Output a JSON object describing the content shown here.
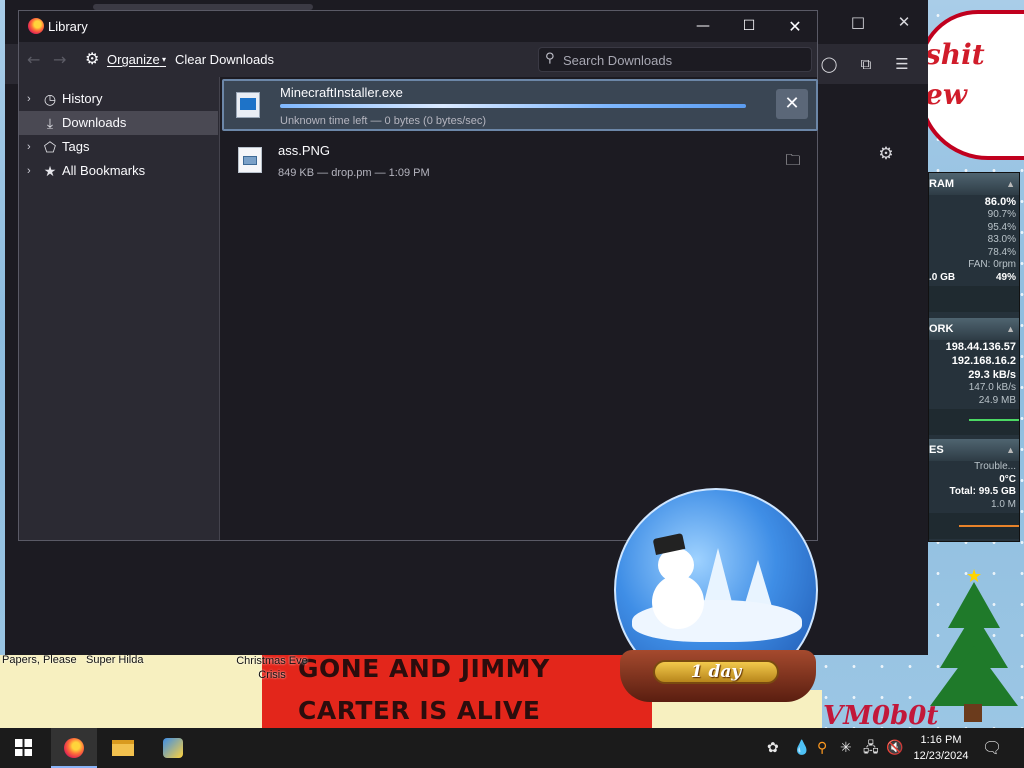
{
  "library": {
    "title": "Library",
    "toolbar": {
      "organize_label": "Organize",
      "clear_downloads_label": "Clear Downloads",
      "search_placeholder": "Search Downloads"
    },
    "sidebar": {
      "items": [
        {
          "label": "History",
          "icon": "history-icon",
          "selected": false
        },
        {
          "label": "Downloads",
          "icon": "download-icon",
          "selected": true
        },
        {
          "label": "Tags",
          "icon": "tag-icon",
          "selected": false
        },
        {
          "label": "All Bookmarks",
          "icon": "star-icon",
          "selected": false
        }
      ]
    },
    "downloads": [
      {
        "name": "MinecraftInstaller.exe",
        "status": "Unknown time left — 0 bytes (0 bytes/sec)",
        "in_progress": true,
        "action": "cancel"
      },
      {
        "name": "ass.PNG",
        "status": "849 KB — drop.pm — 1:09 PM",
        "in_progress": false,
        "action": "open-folder"
      }
    ]
  },
  "desktop": {
    "banner_lines": [
      "GONE AND JIMMY",
      "CARTER IS ALIVE"
    ],
    "icon_labels": [
      "Papers, Please",
      "Super Hilda",
      "Christmas Eve Crisis"
    ],
    "cartoon_text": [
      "shit",
      "ew"
    ],
    "watermark": "VM0b0t",
    "snow_globe_label": "1 day"
  },
  "system_monitor": {
    "ram_header": "RAM",
    "ram_rows": [
      "86.0%",
      "90.7%",
      "95.4%",
      "83.0%",
      "78.4%",
      "FAN: 0rpm"
    ],
    "ram_total": ".0 GB",
    "ram_total_pct": "49%",
    "network_header": "ORK",
    "network_rows": [
      "198.44.136.57",
      "192.168.16.2",
      "29.3 kB/s",
      "147.0 kB/s",
      "24.9 MB"
    ],
    "drives_header": "ES",
    "drives_rows": [
      "Trouble...",
      "0°C",
      "Total: 99.5 GB",
      "1.0 M"
    ]
  },
  "taskbar": {
    "time": "1:16 PM",
    "date": "12/23/2024"
  },
  "colors": {
    "accent": "#7fb8ff",
    "window_bg": "#2b2a33",
    "pane_bg": "#1c1b22",
    "selection": "#3a4654",
    "banner": "#e3261b"
  }
}
